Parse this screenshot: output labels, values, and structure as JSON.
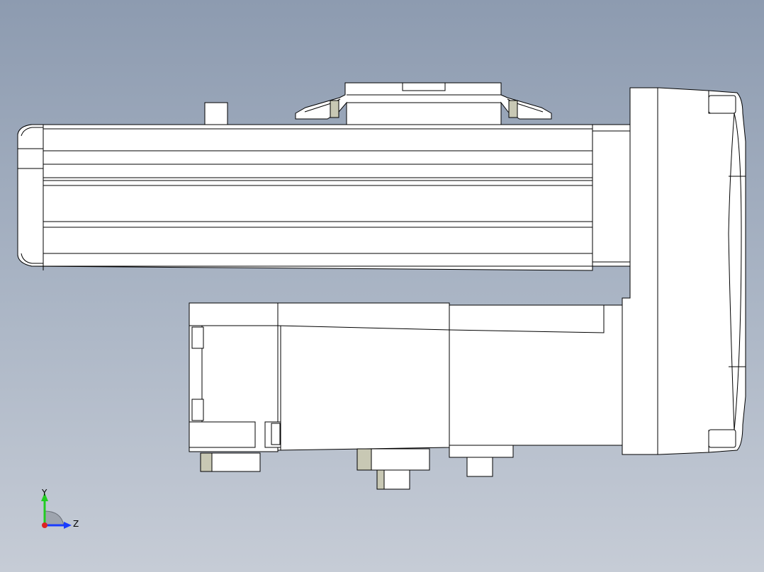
{
  "triad": {
    "y_label": "Y",
    "z_label": "Z",
    "colors": {
      "y": "#22cc22",
      "z": "#1a3cff",
      "x": "#dd2222"
    }
  },
  "colors": {
    "background_top": "#8d9bb0",
    "background_bottom": "#c6ccd6",
    "edge": "#000000",
    "face": "#ffffff",
    "shade": "#c8c8b4"
  }
}
